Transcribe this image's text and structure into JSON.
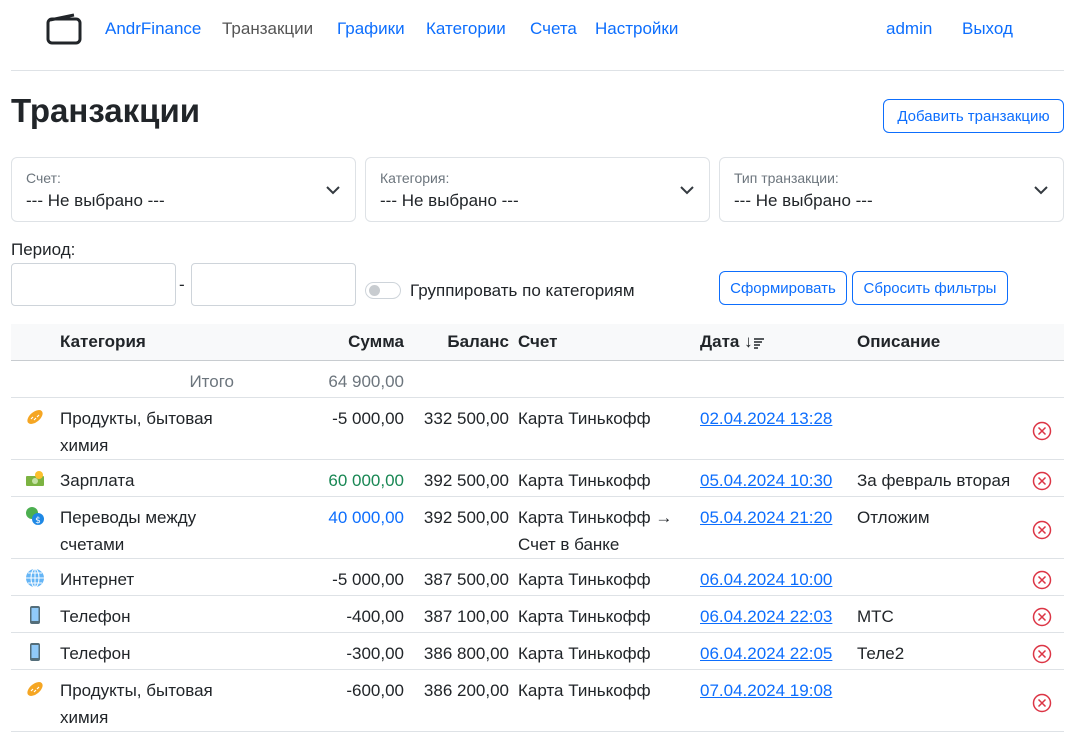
{
  "nav": {
    "brand": "AndrFinance",
    "links": [
      "Транзакции",
      "Графики",
      "Категории",
      "Счета",
      "Настройки"
    ],
    "user": "admin",
    "logout": "Выход"
  },
  "page": {
    "title": "Транзакции",
    "add_button": "Добавить транзакцию"
  },
  "filters": {
    "account": {
      "label": "Счет:",
      "value": "--- Не выбрано ---"
    },
    "category": {
      "label": "Категория:",
      "value": "--- Не выбрано ---"
    },
    "type": {
      "label": "Тип транзакции:",
      "value": "--- Не выбрано ---"
    },
    "period_label": "Период:",
    "period_sep": "-",
    "group_label": "Группировать по категориям",
    "submit": "Сформировать",
    "reset": "Сбросить фильтры"
  },
  "table": {
    "headers": {
      "category": "Категория",
      "amount": "Сумма",
      "balance": "Баланс",
      "account": "Счет",
      "date": "Дата ↓",
      "description": "Описание"
    },
    "total_label": "Итого",
    "total_value": "64 900,00",
    "rows": [
      {
        "icon": "bread-icon",
        "category": "Продукты, бытовая химия",
        "amount": "-5 000,00",
        "kind": "expense",
        "balance": "332 500,00",
        "account": "Карта Тинькофф",
        "date": "02.04.2024 13:28",
        "description": ""
      },
      {
        "icon": "money-icon",
        "category": "Зарплата",
        "amount": "60 000,00",
        "kind": "income",
        "balance": "392 500,00",
        "account": "Карта Тинькофф",
        "date": "05.04.2024 10:30",
        "description": "За февраль вторая"
      },
      {
        "icon": "exchange-icon",
        "category": "Переводы между счетами",
        "amount": "40 000,00",
        "kind": "transfer",
        "balance": "392 500,00",
        "account": "Карта Тинькофф → Счет в банке",
        "date": "05.04.2024 21:20",
        "description": "Отложим"
      },
      {
        "icon": "globe-icon",
        "category": "Интернет",
        "amount": "-5 000,00",
        "kind": "expense",
        "balance": "387 500,00",
        "account": "Карта Тинькофф",
        "date": "06.04.2024 10:00",
        "description": ""
      },
      {
        "icon": "phone-icon",
        "category": "Телефон",
        "amount": "-400,00",
        "kind": "expense",
        "balance": "387 100,00",
        "account": "Карта Тинькофф",
        "date": "06.04.2024 22:03",
        "description": "МТС"
      },
      {
        "icon": "phone-icon",
        "category": "Телефон",
        "amount": "-300,00",
        "kind": "expense",
        "balance": "386 800,00",
        "account": "Карта Тинькофф",
        "date": "06.04.2024 22:05",
        "description": "Теле2"
      },
      {
        "icon": "bread-icon",
        "category": "Продукты, бытовая химия",
        "amount": "-600,00",
        "kind": "expense",
        "balance": "386 200,00",
        "account": "Карта Тинькофф",
        "date": "07.04.2024 19:08",
        "description": ""
      }
    ]
  },
  "colors": {
    "primary": "#0d6efd",
    "income": "#198754",
    "danger": "#dc3545"
  }
}
